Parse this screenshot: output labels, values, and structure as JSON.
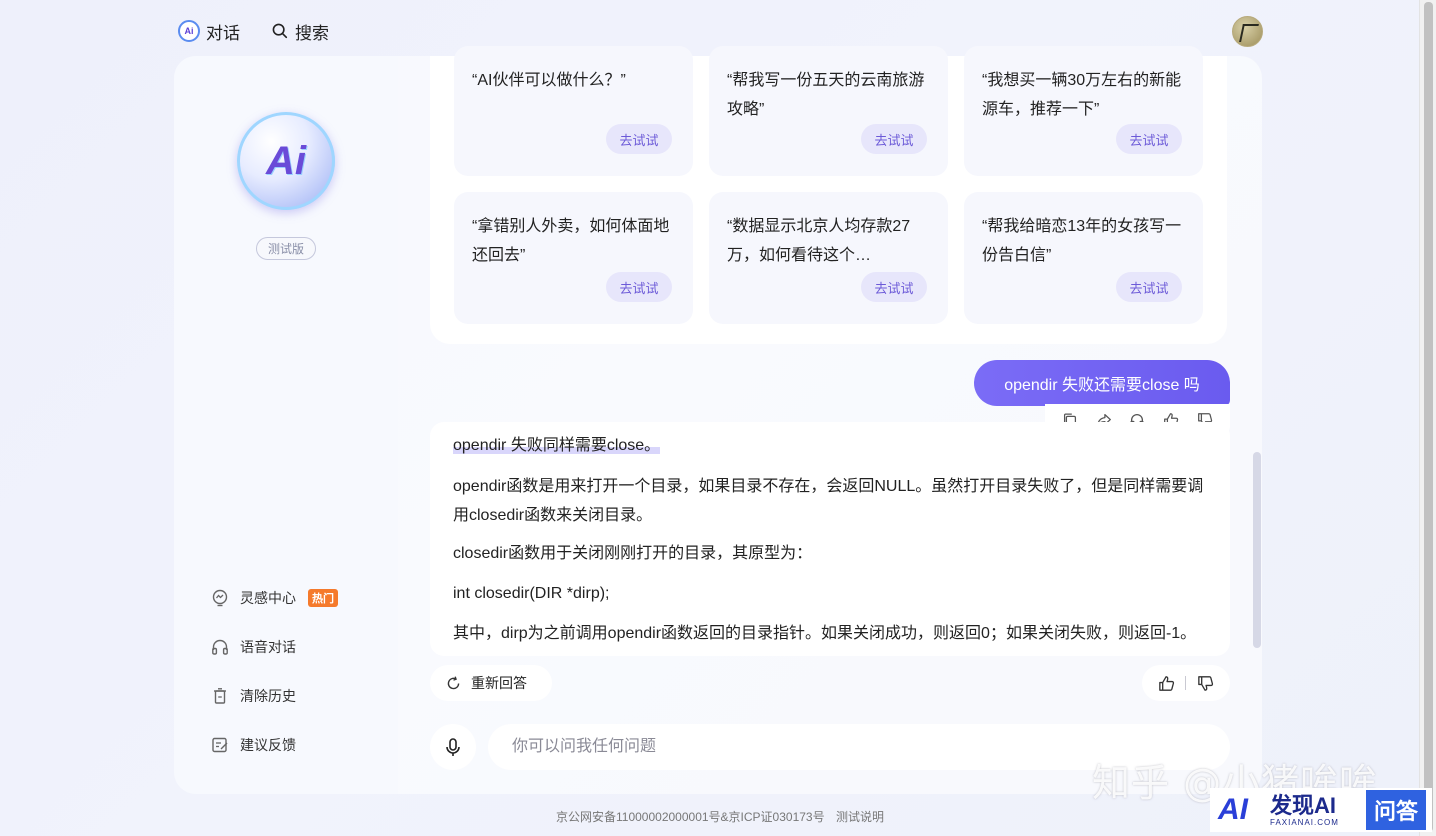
{
  "header": {
    "nav_chat": "对话",
    "nav_chat_logo": "Ai",
    "nav_search": "搜索"
  },
  "sidebar": {
    "logo_text": "Ai",
    "beta_label": "测试版",
    "items": [
      {
        "label": "灵感中心",
        "icon": "lightbulb-icon",
        "badge": "热门"
      },
      {
        "label": "语音对话",
        "icon": "headphones-icon"
      },
      {
        "label": "清除历史",
        "icon": "trash-icon"
      },
      {
        "label": "建议反馈",
        "icon": "feedback-icon"
      }
    ]
  },
  "suggestions": {
    "button_label": "去试试",
    "cards": [
      "“AI伙伴可以做什么？”",
      "“帮我写一份五天的云南旅游攻略”",
      "“我想买一辆30万左右的新能源车，推荐一下”",
      "“拿错别人外卖，如何体面地还回去”",
      "“数据显示北京人均存款27万，如何看待这个…",
      "“帮我给暗恋13年的女孩写一份告白信”"
    ]
  },
  "conversation": {
    "user_message": "opendir 失败还需要close 吗",
    "answer_paragraphs": [
      "opendir 失败同样需要close。",
      "opendir函数是用来打开一个目录，如果目录不存在，会返回NULL。虽然打开目录失败了，但是同样需要调用closedir函数来关闭目录。",
      "closedir函数用于关闭刚刚打开的目录，其原型为：",
      "int closedir(DIR *dirp);",
      "其中，dirp为之前调用opendir函数返回的目录指针。如果关闭成功，则返回0；如果关闭失败，则返回-1。"
    ],
    "regenerate_label": "重新回答"
  },
  "input": {
    "placeholder": "你可以问我任何问题",
    "value": ""
  },
  "footer": {
    "license": "京公网安备11000002000001号&京ICP证030173号",
    "test_notice": "测试说明"
  },
  "watermarks": {
    "zhihu": "知乎 @小猪哞哞",
    "faxian_logo": "AI",
    "faxian_name": "发现AI",
    "faxian_domain": "FAXIANAI.COM",
    "faxian_tag": "问答"
  },
  "colors": {
    "accent": "#6a5bef",
    "accent_light": "#e7e6fb",
    "hot_badge": "#f57a2c"
  }
}
